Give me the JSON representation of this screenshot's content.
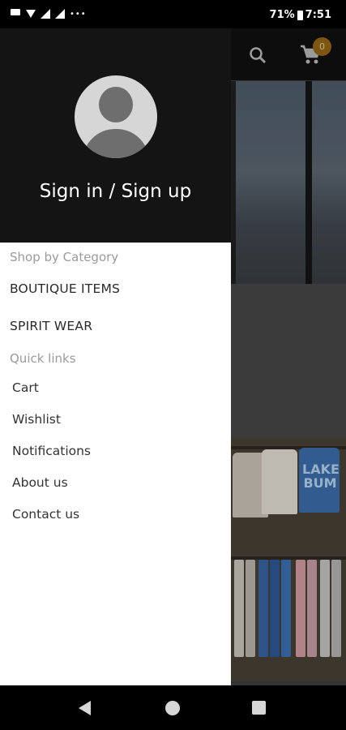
{
  "status_bar": {
    "battery": "71%",
    "time": "7:51"
  },
  "app": {
    "cart_count": "0",
    "shirt_text_line1": "LAKE",
    "shirt_text_line2": "BUM"
  },
  "drawer": {
    "sign_in_label": "Sign in / Sign up",
    "shop_by_category_label": "Shop by Category",
    "categories": [
      "BOUTIQUE ITEMS",
      "SPIRIT WEAR"
    ],
    "quick_links_label": "Quick links",
    "quick_links": [
      "Cart",
      "Wishlist",
      "Notifications",
      "About us",
      "Contact us"
    ]
  },
  "colors": {
    "drawer_header": "#141414",
    "cart_badge": "#9a6a18"
  }
}
